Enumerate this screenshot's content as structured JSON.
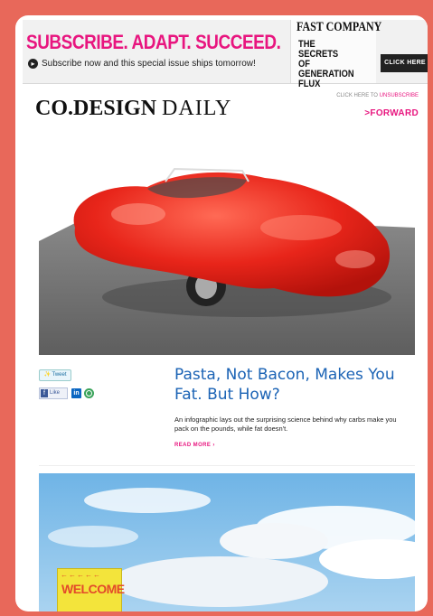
{
  "banner": {
    "headline": "SUBSCRIBE. ADAPT. SUCCEED.",
    "subtext": "Subscribe now and this special issue ships tomorrow!",
    "magazine_brand": "FAST COMPANY",
    "magazine_cover_text": "THE SECRETS OF GENERATION FLUX",
    "cta_label": "CLICK HERE"
  },
  "masthead": {
    "brand_bold": "CO.DESIGN",
    "brand_light": "DAILY",
    "unsubscribe_prefix": "CLICK HERE TO ",
    "unsubscribe_link": "UNSUBSCRIBE",
    "forward_label": ">FORWARD"
  },
  "social": {
    "tweet_label": "Tweet",
    "like_label": "Like",
    "linkedin_label": "in"
  },
  "article": {
    "headline": "Pasta, Not Bacon, Makes You Fat. But How?",
    "description": "An infographic lays out the surprising science behind why carbs make you pack on the pounds, while fat doesn't.",
    "read_more": "READ MORE ›"
  },
  "second_image": {
    "sign_arrows": "←←←←←",
    "sign_text": "WELCOME"
  },
  "colors": {
    "brand_pink": "#e8157f",
    "headline_blue": "#1b63b5",
    "frame_coral": "#e8685a"
  }
}
